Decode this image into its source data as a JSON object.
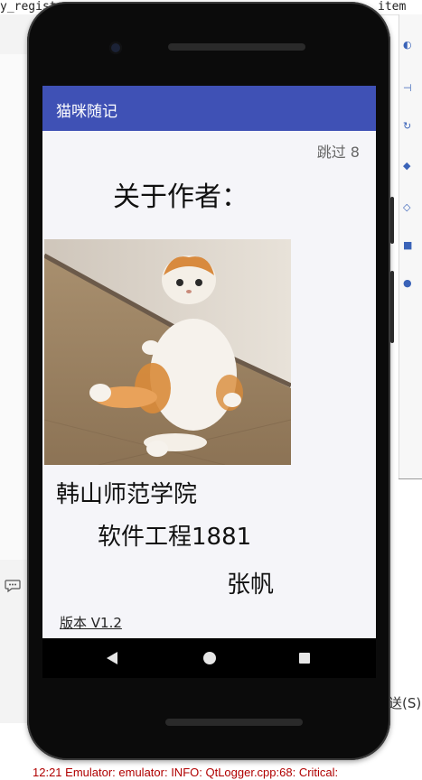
{
  "ide": {
    "top_left_text": "y_regist",
    "top_right_text": "item",
    "right_button_text": "送(S)",
    "log_text": "12:21  Emulator: emulator: INFO: QtLogger.cpp:68: Critical:"
  },
  "app": {
    "title": "猫咪随记",
    "skip_label": "跳过 8",
    "about_heading": "关于作者：",
    "school": "韩山师范学院",
    "major": "软件工程1881",
    "author": "张帆",
    "version": "版本  V1.2"
  },
  "icons": {
    "nav_back": "back-triangle-icon",
    "nav_home": "home-circle-icon",
    "nav_recent": "recent-square-icon",
    "chat": "chat-bubble-icon"
  },
  "colors": {
    "appbar": "#3f51b5",
    "screen_bg": "#f5f5f9",
    "log_text": "#b00000"
  }
}
